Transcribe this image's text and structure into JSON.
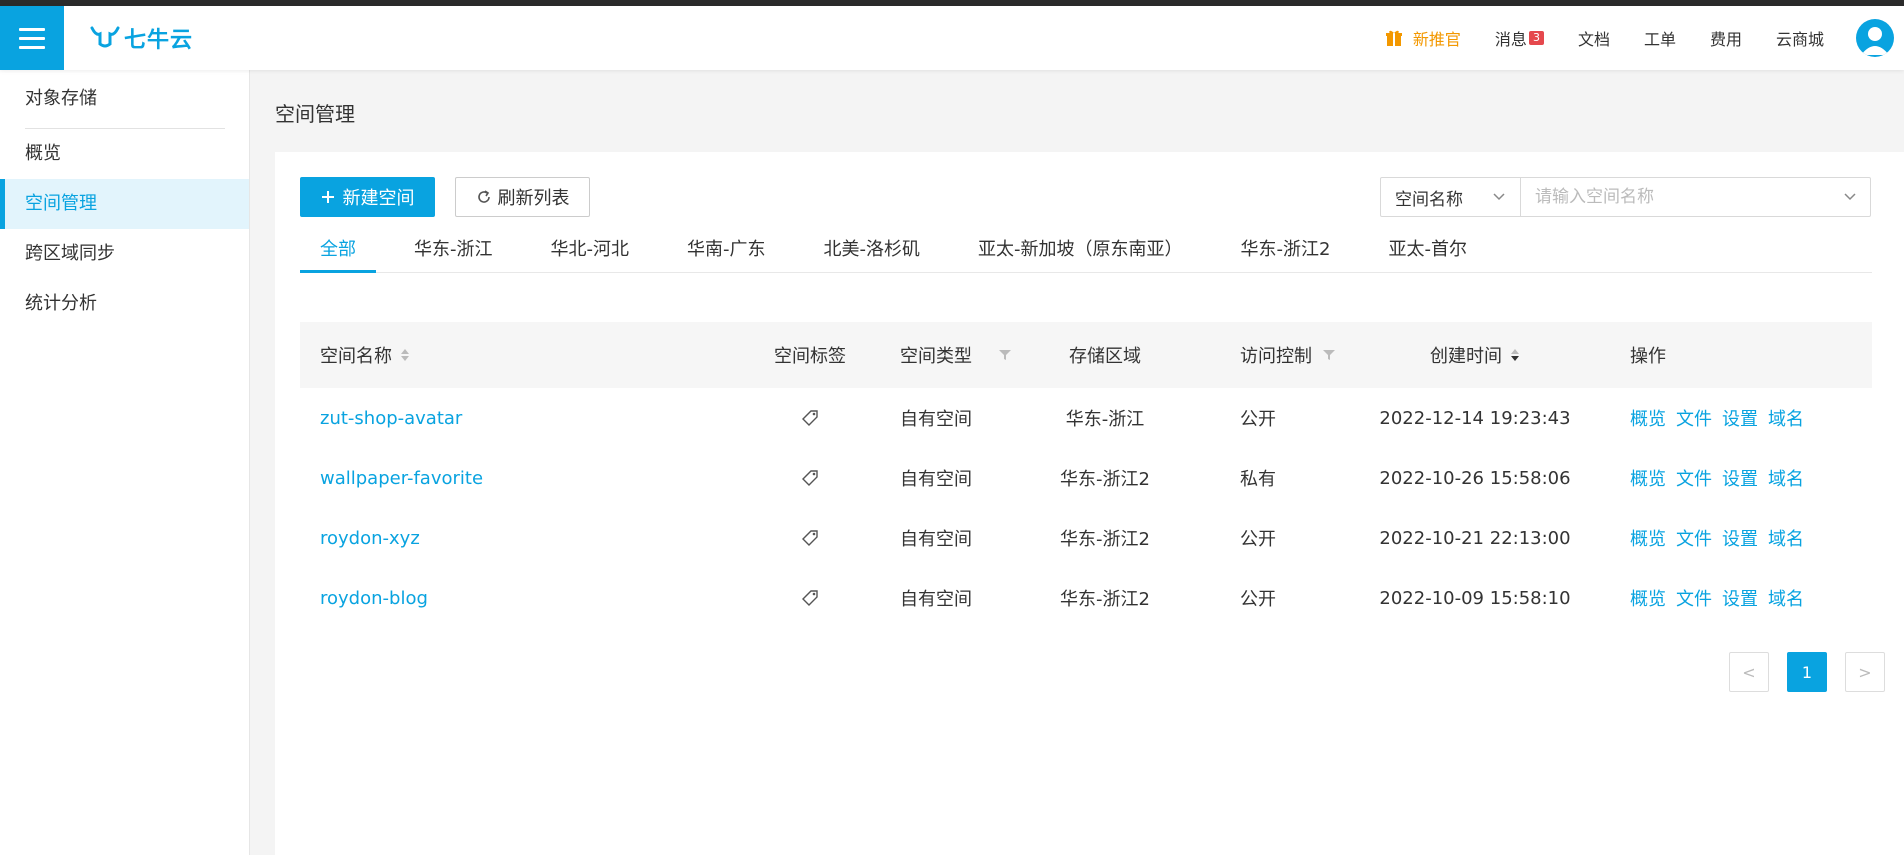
{
  "header": {
    "logo_text": "七牛云",
    "new_label": "新推官",
    "items": [
      {
        "label": "消息",
        "badge": "3"
      },
      {
        "label": "文档"
      },
      {
        "label": "工单"
      },
      {
        "label": "费用"
      },
      {
        "label": "云商城"
      }
    ],
    "brand_color": "#09a3e0"
  },
  "sidebar": {
    "title": "对象存储",
    "items": [
      "概览",
      "空间管理",
      "跨区域同步",
      "统计分析"
    ],
    "active": "空间管理"
  },
  "main": {
    "page_title": "空间管理",
    "toolbar": {
      "create_label": "新建空间",
      "refresh_label": "刷新列表"
    },
    "search": {
      "field_selected": "空间名称",
      "placeholder": "请输入空间名称"
    },
    "tabs": [
      "全部",
      "华东-浙江",
      "华北-河北",
      "华南-广东",
      "北美-洛杉矶",
      "亚太-新加坡（原东南亚）",
      "华东-浙江2",
      "亚太-首尔"
    ],
    "active_tab": "全部",
    "table": {
      "columns": [
        "空间名称",
        "空间标签",
        "空间类型",
        "存储区域",
        "访问控制",
        "创建时间",
        "操作"
      ],
      "rows": [
        {
          "name": "zut-shop-avatar",
          "type": "自有空间",
          "region": "华东-浙江",
          "access": "公开",
          "created": "2022-12-14 19:23:43"
        },
        {
          "name": "wallpaper-favorite",
          "type": "自有空间",
          "region": "华东-浙江2",
          "access": "私有",
          "created": "2022-10-26 15:58:06"
        },
        {
          "name": "roydon-xyz",
          "type": "自有空间",
          "region": "华东-浙江2",
          "access": "公开",
          "created": "2022-10-21 22:13:00"
        },
        {
          "name": "roydon-blog",
          "type": "自有空间",
          "region": "华东-浙江2",
          "access": "公开",
          "created": "2022-10-09 15:58:10"
        }
      ],
      "row_actions": [
        "概览",
        "文件",
        "设置",
        "域名"
      ]
    },
    "pagination": {
      "prev": "<",
      "current": "1",
      "next": ">"
    }
  }
}
